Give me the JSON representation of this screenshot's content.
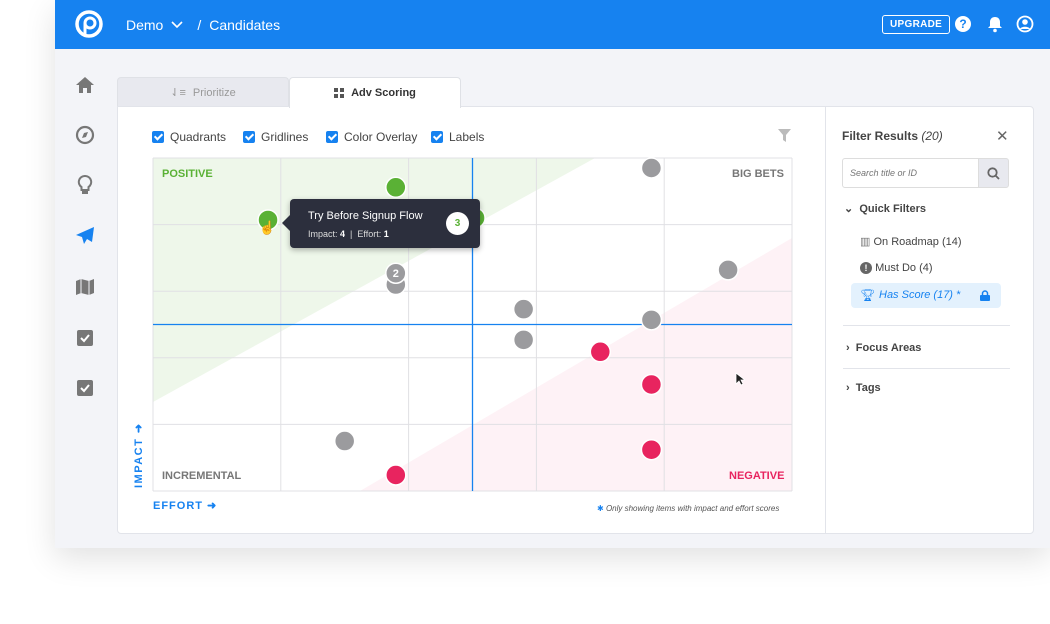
{
  "topbar": {
    "workspace": "Demo",
    "separator": "/",
    "page": "Candidates",
    "upgrade_label": "UPGRADE",
    "icons": [
      "help-icon",
      "bell-icon",
      "user-icon"
    ]
  },
  "sidebar": {
    "items": [
      "home-icon",
      "compass-icon",
      "lightbulb-icon",
      "paper-plane-icon",
      "map-icon",
      "checkbox-icon",
      "checkbox-icon"
    ],
    "active": "paper-plane-icon"
  },
  "tabs": [
    {
      "label": "Prioritize",
      "active": false
    },
    {
      "label": "Adv Scoring",
      "active": true
    }
  ],
  "options": [
    {
      "label": "Quadrants",
      "checked": true
    },
    {
      "label": "Gridlines",
      "checked": true
    },
    {
      "label": "Color Overlay",
      "checked": true
    },
    {
      "label": "Labels",
      "checked": true
    }
  ],
  "colors": {
    "accent": "#1682f0",
    "positive": "#5ab135",
    "negative": "#e8245f",
    "neutral": "#9b9b9e"
  },
  "chart_data": {
    "type": "scatter",
    "xlabel": "EFFORT",
    "ylabel": "IMPACT",
    "xlim": [
      0,
      5
    ],
    "ylim": [
      0,
      5
    ],
    "grid": true,
    "quadrants": {
      "top_left": "POSITIVE",
      "top_right": "BIG BETS",
      "bottom_left": "INCREMENTAL",
      "bottom_right": "NEGATIVE"
    },
    "points": [
      {
        "effort": 1.9,
        "impact": 4.56,
        "group": "positive"
      },
      {
        "effort": 0.9,
        "impact": 4.07,
        "group": "positive"
      },
      {
        "effort": 2.52,
        "impact": 4.1,
        "group": "positive"
      },
      {
        "effort": 3.9,
        "impact": 4.85,
        "group": "neutral"
      },
      {
        "effort": 1.9,
        "impact": 3.1,
        "group": "neutral"
      },
      {
        "effort": 1.9,
        "impact": 3.27,
        "group": "neutral",
        "count": "2"
      },
      {
        "effort": 4.5,
        "impact": 3.32,
        "group": "neutral"
      },
      {
        "effort": 2.9,
        "impact": 2.73,
        "group": "neutral"
      },
      {
        "effort": 3.9,
        "impact": 2.57,
        "group": "neutral"
      },
      {
        "effort": 2.9,
        "impact": 2.27,
        "group": "neutral"
      },
      {
        "effort": 3.5,
        "impact": 2.09,
        "group": "negative"
      },
      {
        "effort": 3.9,
        "impact": 1.6,
        "group": "negative"
      },
      {
        "effort": 1.5,
        "impact": 0.75,
        "group": "neutral"
      },
      {
        "effort": 3.9,
        "impact": 0.62,
        "group": "negative"
      },
      {
        "effort": 1.9,
        "impact": 0.24,
        "group": "negative"
      }
    ],
    "tooltip": {
      "title": "Try Before Signup Flow",
      "impact_label": "Impact:",
      "impact": "4",
      "effort_label": "Effort:",
      "effort": "1",
      "badge": "3"
    },
    "footnote": "Only showing items with impact and effort scores"
  },
  "filter": {
    "title": "Filter Results",
    "count": "(20)",
    "search_placeholder": "Search title or ID",
    "quick_filters": "Quick Filters",
    "items": [
      {
        "label": "On Roadmap (14)",
        "icon": "map-icon"
      },
      {
        "label": "Must Do (4)",
        "icon": "exclamation-icon"
      },
      {
        "label": "Has Score (17) *",
        "icon": "trophy-icon",
        "selected": true,
        "locked": true
      }
    ],
    "sections": [
      "Focus Areas",
      "Tags"
    ]
  }
}
